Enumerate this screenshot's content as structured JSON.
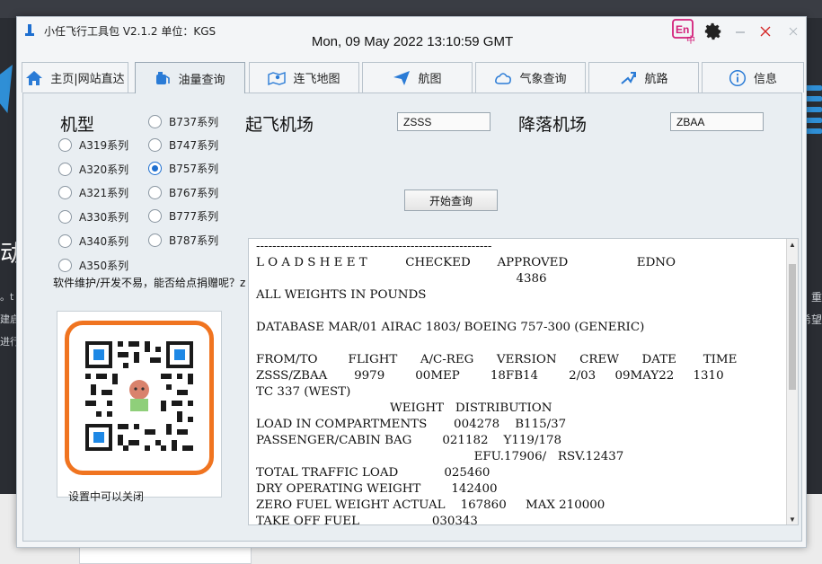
{
  "window": {
    "title": "小任飞行工具包 V2.1.2 单位：KGS",
    "clock": "Mon, 09 May 2022 13:10:59 GMT",
    "lang_button": "En",
    "lang_sub": "中"
  },
  "tabs": [
    {
      "label": "主页|网站直达",
      "icon": "home-icon"
    },
    {
      "label": "油量查询",
      "icon": "fuel-icon"
    },
    {
      "label": "连飞地图",
      "icon": "map-icon"
    },
    {
      "label": "航图",
      "icon": "send-icon"
    },
    {
      "label": "气象查询",
      "icon": "weather-icon"
    },
    {
      "label": "航路",
      "icon": "route-icon"
    },
    {
      "label": "信息",
      "icon": "info-icon"
    }
  ],
  "active_tab": 1,
  "form": {
    "type_label": "机型",
    "departure_label": "起飞机场",
    "departure_value": "ZSSS",
    "arrival_label": "降落机场",
    "arrival_value": "ZBAA",
    "query_button": "开始查询",
    "aircraft_left": [
      "A319系列",
      "A320系列",
      "A321系列",
      "A330系列",
      "A340系列",
      "A350系列"
    ],
    "aircraft_right": [
      "B737系列",
      "B747系列",
      "B757系列",
      "B767系列",
      "B777系列",
      "B787系列"
    ],
    "selected": "B757系列",
    "donate_text": "软件维护/开发不易，能否给点捐赠呢？z",
    "qr_note": "设置中可以关闭"
  },
  "loadsheet": {
    "lines": [
      "----------------------------------------------------------",
      "L O A D S H E E T          CHECKED       APPROVED                  EDNO",
      "                                                                    4386",
      "ALL WEIGHTS IN POUNDS",
      "",
      "DATABASE MAR/01 AIRAC 1803/ BOEING 757-300 (GENERIC)",
      "",
      "FROM/TO        FLIGHT      A/C-REG      VERSION      CREW      DATE       TIME",
      "ZSSS/ZBAA       9979        00MEP        18FB14        2/03     09MAY22     1310",
      "TC 337 (WEST)",
      "                                   WEIGHT   DISTRIBUTION",
      "LOAD IN COMPARTMENTS       004278    B115/37",
      "PASSENGER/CABIN BAG        021182    Y119/178",
      "                                                         EFU.17906/   RSV.12437",
      "TOTAL TRAFFIC LOAD            025460",
      "DRY OPERATING WEIGHT        142400",
      "ZERO FUEL WEIGHT ACTUAL    167860     MAX 210000",
      "TAKE OFF FUEL                   030343"
    ]
  },
  "background": {
    "left_glyph": "动",
    "left_small_1": "。t",
    "left_small_2": "建启",
    "left_small_3": "进行",
    "right_small_1": "，重",
    "right_small_2": "希望"
  },
  "colors": {
    "accent": "#1e6fd0",
    "qr_frame": "#f07420",
    "lang_button": "#d3207a",
    "close_icon": "#d42424"
  }
}
